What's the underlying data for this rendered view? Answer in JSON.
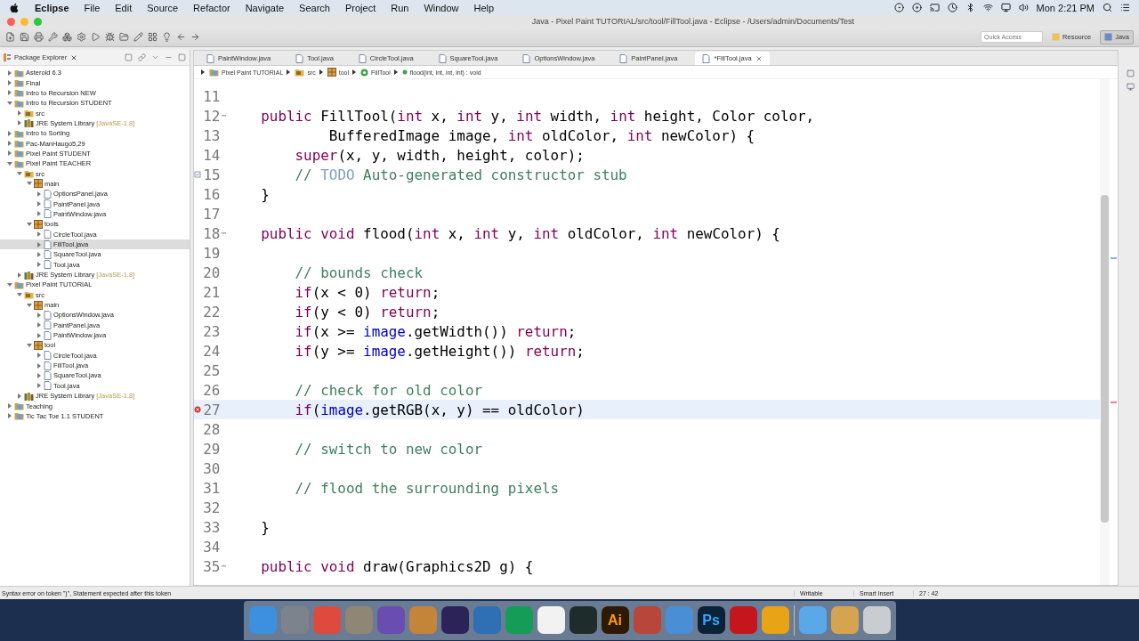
{
  "menu_bar": {
    "app": "Eclipse",
    "items": [
      "File",
      "Edit",
      "Source",
      "Refactor",
      "Navigate",
      "Search",
      "Project",
      "Run",
      "Window",
      "Help"
    ],
    "clock": "Mon 2:21 PM"
  },
  "window": {
    "title": "Java - Pixel Paint TUTORIAL/src/tool/FillTool.java - Eclipse - /Users/admin/Documents/Test"
  },
  "toolbar": {
    "quick_access": {
      "placeholder": "Quick Access"
    },
    "perspectives": [
      {
        "label": "Resource",
        "selected": false
      },
      {
        "label": "Java",
        "selected": true
      }
    ]
  },
  "package_explorer": {
    "title": "Package Explorer",
    "tree": [
      {
        "label": "Asteroid 6.3",
        "kind": "project",
        "expanded": false,
        "selected": false
      },
      {
        "label": "Final",
        "kind": "project",
        "expanded": false,
        "selected": false
      },
      {
        "label": "Intro to Recursion NEW",
        "kind": "project",
        "expanded": false,
        "selected": false
      },
      {
        "label": "Intro to Recursion STUDENT",
        "kind": "project",
        "expanded": true,
        "selected": false,
        "children": [
          {
            "label": "src",
            "kind": "folder",
            "expanded": false,
            "selected": false
          },
          {
            "label": "JRE System Library",
            "decoration": "[JavaSE-1.8]",
            "kind": "library",
            "expanded": false,
            "selected": false
          }
        ]
      },
      {
        "label": "Intro to Sorting",
        "kind": "project",
        "expanded": false,
        "selected": false
      },
      {
        "label": "Pac-ManHaugo5,29",
        "kind": "project",
        "expanded": false,
        "selected": false
      },
      {
        "label": "Pixel Paint STUDENT",
        "kind": "project",
        "expanded": false,
        "selected": false
      },
      {
        "label": "Pixel Paint TEACHER",
        "kind": "project",
        "expanded": true,
        "selected": false,
        "children": [
          {
            "label": "src",
            "kind": "folder",
            "expanded": true,
            "selected": false,
            "children": [
              {
                "label": "main",
                "kind": "package",
                "expanded": true,
                "selected": false,
                "children": [
                  {
                    "label": "OptionsPanel.java",
                    "kind": "java",
                    "expanded": false,
                    "selected": false
                  },
                  {
                    "label": "PaintPanel.java",
                    "kind": "java",
                    "expanded": false,
                    "selected": false
                  },
                  {
                    "label": "PaintWindow.java",
                    "kind": "java",
                    "expanded": false,
                    "selected": false
                  }
                ]
              },
              {
                "label": "tools",
                "kind": "package",
                "expanded": true,
                "selected": false,
                "children": [
                  {
                    "label": "CircleTool.java",
                    "kind": "java",
                    "expanded": false,
                    "selected": false
                  },
                  {
                    "label": "FillTool.java",
                    "kind": "java",
                    "expanded": false,
                    "selected": true
                  },
                  {
                    "label": "SquareTool.java",
                    "kind": "java",
                    "expanded": false,
                    "selected": false
                  },
                  {
                    "label": "Tool.java",
                    "kind": "java",
                    "expanded": false,
                    "selected": false
                  }
                ]
              }
            ]
          },
          {
            "label": "JRE System Library",
            "decoration": "[JavaSE-1.8]",
            "kind": "library",
            "expanded": false,
            "selected": false
          }
        ]
      },
      {
        "label": "Pixel Paint TUTORIAL",
        "kind": "project",
        "expanded": true,
        "selected": false,
        "children": [
          {
            "label": "src",
            "kind": "folder",
            "expanded": true,
            "selected": false,
            "children": [
              {
                "label": "main",
                "kind": "package",
                "expanded": true,
                "selected": false,
                "children": [
                  {
                    "label": "OptionsWindow.java",
                    "kind": "java",
                    "expanded": false,
                    "selected": false
                  },
                  {
                    "label": "PaintPanel.java",
                    "kind": "java",
                    "expanded": false,
                    "selected": false
                  },
                  {
                    "label": "PaintWindow.java",
                    "kind": "java",
                    "expanded": false,
                    "selected": false
                  }
                ]
              },
              {
                "label": "tool",
                "kind": "package",
                "expanded": true,
                "selected": false,
                "children": [
                  {
                    "label": "CircleTool.java",
                    "kind": "java",
                    "expanded": false,
                    "selected": false
                  },
                  {
                    "label": "FillTool.java",
                    "kind": "java",
                    "expanded": false,
                    "selected": false
                  },
                  {
                    "label": "SquareTool.java",
                    "kind": "java",
                    "expanded": false,
                    "selected": false
                  },
                  {
                    "label": "Tool.java",
                    "kind": "java",
                    "expanded": false,
                    "selected": false
                  }
                ]
              }
            ]
          },
          {
            "label": "JRE System Library",
            "decoration": "[JavaSE-1.8]",
            "kind": "library",
            "expanded": false,
            "selected": false
          }
        ]
      },
      {
        "label": "Teaching",
        "kind": "project",
        "expanded": false,
        "selected": false
      },
      {
        "label": "Tic Tac Toe 1.1 STUDENT",
        "kind": "project",
        "expanded": false,
        "selected": false
      }
    ]
  },
  "editor": {
    "tabs": [
      {
        "label": "PaintWindow.java",
        "selected": false
      },
      {
        "label": "Tool.java",
        "selected": false
      },
      {
        "label": "CircleTool.java",
        "selected": false
      },
      {
        "label": "SquareTool.java",
        "selected": false
      },
      {
        "label": "OptionsWindow.java",
        "selected": false
      },
      {
        "label": "PaintPanel.java",
        "selected": false
      },
      {
        "label": "*FillTool.java",
        "selected": true
      }
    ],
    "breadcrumb": [
      {
        "label": "Pixel Paint TUTORIAL",
        "kind": "project"
      },
      {
        "label": "src",
        "kind": "folder"
      },
      {
        "label": "tool",
        "kind": "package"
      },
      {
        "label": "FillTool",
        "kind": "class"
      },
      {
        "label": "flood(int, int, int, int) : void",
        "kind": "method"
      }
    ],
    "lines": [
      {
        "number": "11"
      },
      {
        "number": "12",
        "fold": true,
        "tokens": [
          {
            "text": "    public",
            "kind": "keyword"
          },
          {
            "text": " FillTool(",
            "kind": "plain"
          },
          {
            "text": "int",
            "kind": "keyword"
          },
          {
            "text": " x, ",
            "kind": "plain"
          },
          {
            "text": "int",
            "kind": "keyword"
          },
          {
            "text": " y, ",
            "kind": "plain"
          },
          {
            "text": "int",
            "kind": "keyword"
          },
          {
            "text": " width, ",
            "kind": "plain"
          },
          {
            "text": "int",
            "kind": "keyword"
          },
          {
            "text": " height, Color color,",
            "kind": "plain"
          }
        ]
      },
      {
        "number": "13",
        "tokens": [
          {
            "text": "            BufferedImage image, ",
            "kind": "plain"
          },
          {
            "text": "int",
            "kind": "keyword"
          },
          {
            "text": " oldColor, ",
            "kind": "plain"
          },
          {
            "text": "int",
            "kind": "keyword"
          },
          {
            "text": " newColor) {",
            "kind": "plain"
          }
        ]
      },
      {
        "number": "14",
        "tokens": [
          {
            "text": "        super",
            "kind": "keyword"
          },
          {
            "text": "(x, y, width, height, color);",
            "kind": "plain"
          }
        ]
      },
      {
        "number": "15",
        "marker": {
          "kind": "task"
        },
        "tokens": [
          {
            "text": "        // ",
            "kind": "comment"
          },
          {
            "text": "TODO",
            "kind": "todo"
          },
          {
            "text": " Auto-generated constructor stub",
            "kind": "comment"
          }
        ]
      },
      {
        "number": "16",
        "tokens": [
          {
            "text": "    }",
            "kind": "plain"
          }
        ]
      },
      {
        "number": "17"
      },
      {
        "number": "18",
        "fold": true,
        "tokens": [
          {
            "text": "    public void",
            "kind": "keyword"
          },
          {
            "text": " flood(",
            "kind": "plain"
          },
          {
            "text": "int",
            "kind": "keyword"
          },
          {
            "text": " x, ",
            "kind": "plain"
          },
          {
            "text": "int",
            "kind": "keyword"
          },
          {
            "text": " y, ",
            "kind": "plain"
          },
          {
            "text": "int",
            "kind": "keyword"
          },
          {
            "text": " oldColor, ",
            "kind": "plain"
          },
          {
            "text": "int",
            "kind": "keyword"
          },
          {
            "text": " newColor) {",
            "kind": "plain"
          }
        ]
      },
      {
        "number": "19"
      },
      {
        "number": "20",
        "tokens": [
          {
            "text": "        // bounds check",
            "kind": "comment"
          }
        ]
      },
      {
        "number": "21",
        "tokens": [
          {
            "text": "        if",
            "kind": "keyword"
          },
          {
            "text": "(x < 0) ",
            "kind": "plain"
          },
          {
            "text": "return",
            "kind": "keyword"
          },
          {
            "text": ";",
            "kind": "plain"
          }
        ]
      },
      {
        "number": "22",
        "tokens": [
          {
            "text": "        if",
            "kind": "keyword"
          },
          {
            "text": "(y < 0) ",
            "kind": "plain"
          },
          {
            "text": "return",
            "kind": "keyword"
          },
          {
            "text": ";",
            "kind": "plain"
          }
        ]
      },
      {
        "number": "23",
        "tokens": [
          {
            "text": "        if",
            "kind": "keyword"
          },
          {
            "text": "(x >= ",
            "kind": "plain"
          },
          {
            "text": "image",
            "kind": "field"
          },
          {
            "text": ".getWidth()) ",
            "kind": "plain"
          },
          {
            "text": "return",
            "kind": "keyword"
          },
          {
            "text": ";",
            "kind": "plain"
          }
        ]
      },
      {
        "number": "24",
        "tokens": [
          {
            "text": "        if",
            "kind": "keyword"
          },
          {
            "text": "(y >= ",
            "kind": "plain"
          },
          {
            "text": "image",
            "kind": "field"
          },
          {
            "text": ".getHeight()) ",
            "kind": "plain"
          },
          {
            "text": "return",
            "kind": "keyword"
          },
          {
            "text": ";",
            "kind": "plain"
          }
        ]
      },
      {
        "number": "25"
      },
      {
        "number": "26",
        "tokens": [
          {
            "text": "        // check for old color",
            "kind": "comment"
          }
        ]
      },
      {
        "number": "27",
        "marker": {
          "kind": "error"
        },
        "current": true,
        "tokens": [
          {
            "text": "        if",
            "kind": "keyword"
          },
          {
            "text": "(",
            "kind": "plain"
          },
          {
            "text": "image",
            "kind": "field"
          },
          {
            "text": ".getRGB(x, y) == oldColor)",
            "kind": "plain"
          }
        ]
      },
      {
        "number": "28"
      },
      {
        "number": "29",
        "tokens": [
          {
            "text": "        // switch to new color",
            "kind": "comment"
          }
        ]
      },
      {
        "number": "30"
      },
      {
        "number": "31",
        "tokens": [
          {
            "text": "        // flood the surrounding pixels",
            "kind": "comment"
          }
        ]
      },
      {
        "number": "32"
      },
      {
        "number": "33",
        "tokens": [
          {
            "text": "    }",
            "kind": "plain"
          }
        ]
      },
      {
        "number": "34"
      },
      {
        "number": "35",
        "fold": true,
        "tokens": [
          {
            "text": "    public void",
            "kind": "keyword"
          },
          {
            "text": " draw(Graphics2D g) {",
            "kind": "plain"
          }
        ]
      }
    ]
  },
  "status_bar": {
    "message": "Syntax error on token \")\", Statement expected after this token",
    "mode": "Writable",
    "insert": "Smart Insert",
    "position": "27 : 42"
  },
  "dock": [
    {
      "color": "#3d8fe0"
    },
    {
      "color": "#7d838c"
    },
    {
      "color": "#de4b3e"
    },
    {
      "color": "#8f8676"
    },
    {
      "color": "#6a4db0"
    },
    {
      "color": "#c4853a"
    },
    {
      "color": "#2c2458"
    },
    {
      "color": "#2f6fb3"
    },
    {
      "color": "#159d58"
    },
    {
      "color": "#f2f2f2"
    },
    {
      "color": "#1e2c2c"
    },
    {
      "color": "#2e1a02",
      "label": {
        "text": "Ai",
        "color": "#ff9a00"
      }
    },
    {
      "color": "#b8463a"
    },
    {
      "color": "#4a8fd6"
    },
    {
      "color": "#0b2238",
      "label": {
        "text": "Ps",
        "color": "#31a8ff"
      }
    },
    {
      "color": "#c4161c"
    },
    {
      "color": "#e8a317"
    },
    {
      "color": "#5aa8e8"
    },
    {
      "color": "#d6a450"
    },
    {
      "color": "#c9cdd2"
    }
  ]
}
